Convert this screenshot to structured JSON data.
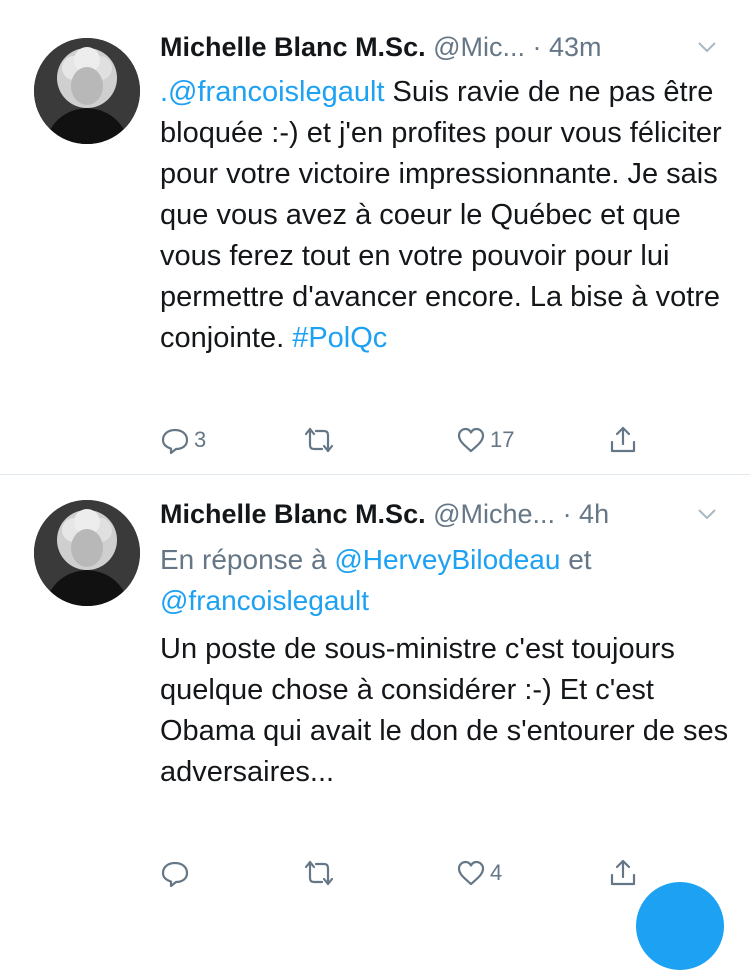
{
  "tweets": [
    {
      "name": "Michelle Blanc M.Sc.",
      "handle": "@Mic...",
      "time": "· 43m",
      "text_mention": ".@francoislegault",
      "text_body": " Suis ravie de ne pas être bloquée :-) et j'en profites pour vous féliciter pour votre victoire impressionnante. Je sais que vous avez à coeur le Québec et que vous ferez tout en votre pouvoir pour lui permettre d'avancer encore. La bise à votre conjointe. ",
      "hashtag": "#PolQc",
      "replies": "3",
      "retweets": "",
      "likes": "17"
    },
    {
      "name": "Michelle Blanc M.Sc.",
      "handle": "@Miche...",
      "time": "· 4h",
      "reply_prefix": "En réponse à ",
      "reply_mention_1": "@HerveyBilodeau",
      "reply_mid": " et ",
      "reply_mention_2": "@francoislegault",
      "text_body": "Un poste de sous-ministre c'est toujours quelque chose à considérer :-) Et c'est Obama qui avait le don de s'entourer de ses adversaires...",
      "replies": "",
      "retweets": "",
      "likes": "4"
    }
  ],
  "colors": {
    "accent": "#1da1f2",
    "muted": "#657786",
    "text": "#14171a"
  },
  "icons": [
    "reply-icon",
    "retweet-icon",
    "like-icon",
    "share-icon",
    "chevron-down-icon"
  ]
}
